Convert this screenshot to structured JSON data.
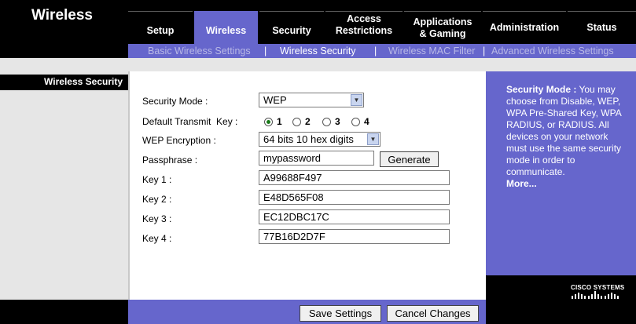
{
  "header": {
    "title": "Wireless"
  },
  "tabs": [
    {
      "label": "Setup"
    },
    {
      "label": "Wireless"
    },
    {
      "label": "Security"
    },
    {
      "label": "Access\nRestrictions"
    },
    {
      "label": "Applications\n& Gaming"
    },
    {
      "label": "Administration"
    },
    {
      "label": "Status"
    }
  ],
  "subnav": {
    "items": [
      "Basic Wireless Settings",
      "Wireless Security",
      "Wireless MAC Filter",
      "Advanced Wireless Settings"
    ],
    "separator": "|"
  },
  "sidebar": {
    "section_label": "Wireless Security"
  },
  "form": {
    "security_mode_label": "Security Mode :",
    "security_mode_value": "WEP",
    "transmit_key_label": "Default Transmit  Key :",
    "transmit_keys": [
      "1",
      "2",
      "3",
      "4"
    ],
    "transmit_key_selected": "1",
    "encryption_label": "WEP Encryption :",
    "encryption_value": "64 bits 10 hex digits",
    "passphrase_label": "Passphrase :",
    "passphrase_value": "mypassword",
    "generate_label": "Generate",
    "key1_label": "Key 1 :",
    "key1_value": "A99688F497",
    "key2_label": "Key 2 :",
    "key2_value": "E48D565F08",
    "key3_label": "Key 3 :",
    "key3_value": "EC12DBC17C",
    "key4_label": "Key 4 :",
    "key4_value": "77B16D2D7F"
  },
  "help": {
    "heading": "Security Mode :",
    "body": "You may choose from Disable, WEP, WPA Pre-Shared Key, WPA RADIUS, or RADIUS. All devices on your network must use the same security mode in order to communicate.",
    "more": "More..."
  },
  "brand": {
    "vendor": "CISCO SYSTEMS"
  },
  "footer": {
    "save_label": "Save Settings",
    "cancel_label": "Cancel Changes"
  },
  "colors": {
    "accent": "#6666cc",
    "background": "#000000",
    "panel": "#e6e6e6"
  },
  "icons": {
    "select_arrow": "chevron-down-icon",
    "logo": "cisco-bars-logo"
  }
}
